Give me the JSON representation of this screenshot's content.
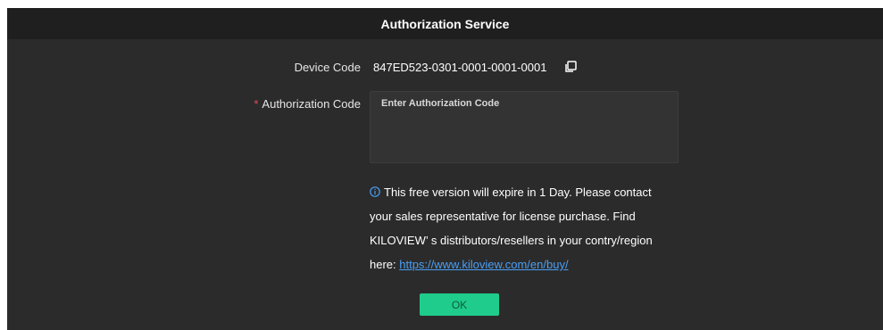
{
  "dialog": {
    "title": "Authorization Service"
  },
  "device_code": {
    "label": "Device Code",
    "value": "847ED523-0301-0001-0001-0001",
    "copy_icon": "copy-icon"
  },
  "authorization_code": {
    "required_mark": "*",
    "label": "Authorization Code",
    "placeholder": "Enter Authorization Code",
    "value": ""
  },
  "notice": {
    "icon": "info-icon",
    "line1": "This free version will expire in 1 Day. Please contact",
    "line2": "your sales representative for license purchase. Find",
    "line3": "KILOVIEW’ s distributors/resellers in your contry/region",
    "line4_prefix": "here: ",
    "link_text": "https://www.kiloview.com/en/buy/"
  },
  "ok_button": {
    "label": "OK"
  },
  "colors": {
    "dialog_background": "#2b2b2b",
    "titlebar_background": "#1f1f1f",
    "accent_green": "#1fcc8b",
    "link_blue": "#4a9ff5",
    "required_red": "#e34d59"
  }
}
